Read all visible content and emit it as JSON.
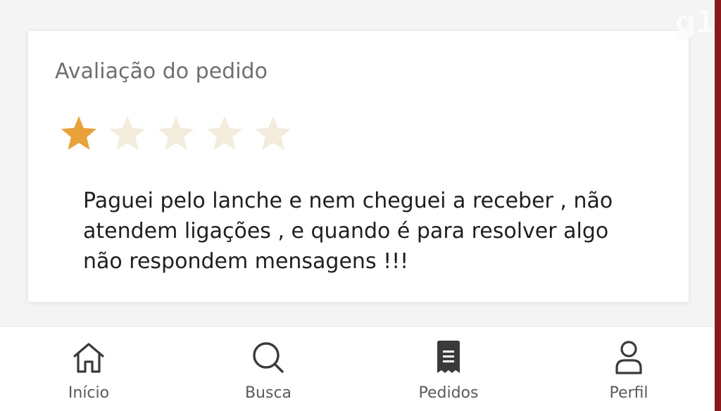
{
  "watermark": "g1",
  "review_card": {
    "title": "Avaliação do pedido",
    "rating": 1,
    "max_rating": 5,
    "star_filled_color": "#E9A23B",
    "star_empty_color": "#F3EBDC",
    "comment_lines": [
      "Paguei pelo lanche e nem cheguei a receber , não",
      "atendem ligações , e quando é para resolver algo",
      "não respondem mensagens !!!"
    ]
  },
  "tabbar": {
    "tabs": [
      {
        "label": "Início",
        "icon": "home-icon",
        "active": false
      },
      {
        "label": "Busca",
        "icon": "search-icon",
        "active": false
      },
      {
        "label": "Pedidos",
        "icon": "receipt-icon",
        "active": true
      },
      {
        "label": "Perfil",
        "icon": "user-icon",
        "active": false
      }
    ]
  }
}
